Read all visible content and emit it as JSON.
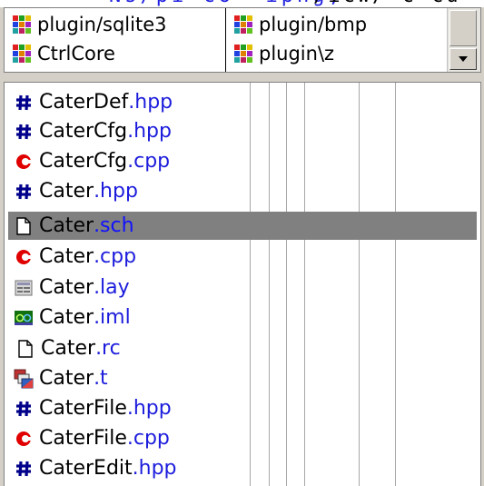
{
  "top_strip": {
    "left_text": "Ns/pi-co-'ipng,",
    "right_text": "/icw/-c-cu"
  },
  "packages": {
    "col1": [
      {
        "label": "plugin/sqlite3",
        "icon": "package-icon"
      },
      {
        "label": "CtrlCore",
        "icon": "package-icon"
      }
    ],
    "col2": [
      {
        "label": "plugin/bmp",
        "icon": "package-icon"
      },
      {
        "label": "plugin\\z",
        "icon": "package-icon"
      }
    ]
  },
  "files": [
    {
      "name": "CaterDef",
      "ext": ".hpp",
      "icon": "header-file-icon"
    },
    {
      "name": "CaterCfg",
      "ext": ".hpp",
      "icon": "header-file-icon"
    },
    {
      "name": "CaterCfg",
      "ext": ".cpp",
      "icon": "cpp-file-icon"
    },
    {
      "name": "Cater",
      "ext": ".hpp",
      "icon": "header-file-icon"
    },
    {
      "name": "Cater",
      "ext": ".sch",
      "icon": "text-file-icon",
      "selected": true
    },
    {
      "name": "Cater",
      "ext": ".cpp",
      "icon": "cpp-file-icon"
    },
    {
      "name": "Cater",
      "ext": ".lay",
      "icon": "layout-file-icon"
    },
    {
      "name": "Cater",
      "ext": ".iml",
      "icon": "image-file-icon"
    },
    {
      "name": "Cater",
      "ext": ".rc",
      "icon": "text-file-icon"
    },
    {
      "name": "Cater",
      "ext": ".t",
      "icon": "translation-file-icon"
    },
    {
      "name": "CaterFile",
      "ext": ".hpp",
      "icon": "header-file-icon"
    },
    {
      "name": "CaterFile",
      "ext": ".cpp",
      "icon": "cpp-file-icon"
    },
    {
      "name": "CaterEdit",
      "ext": ".hpp",
      "icon": "header-file-icon"
    }
  ],
  "colors": {
    "selection": "#808080",
    "extension": "#1c1cdc",
    "header_icon": "#00008b",
    "cpp_icon": "#e00000"
  }
}
